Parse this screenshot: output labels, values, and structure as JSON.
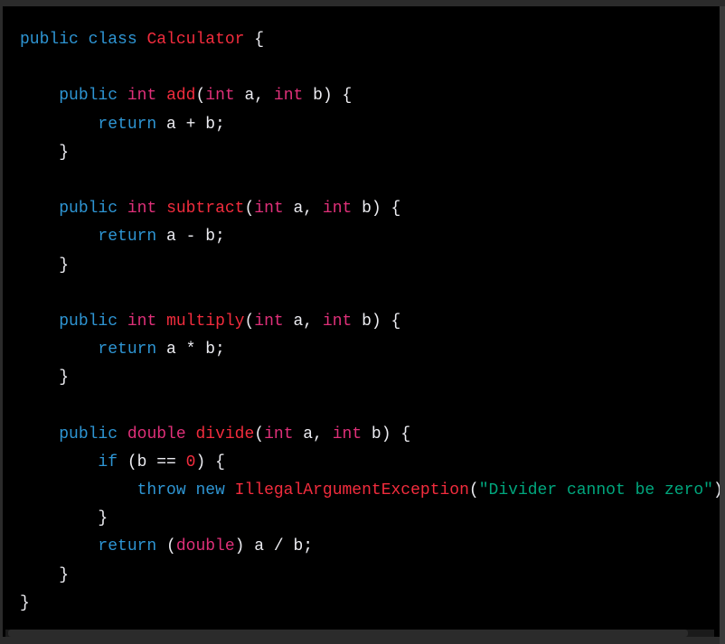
{
  "language": "java",
  "colors": {
    "keyword": "#2e95d3",
    "type": "#df3079",
    "function": "#f22c3d",
    "string": "#00a67d",
    "text": "#ececf1",
    "background": "#000000"
  },
  "lines": [
    [
      [
        "kw",
        "public"
      ],
      [
        "tx",
        " "
      ],
      [
        "kw",
        "class"
      ],
      [
        "tx",
        " "
      ],
      [
        "fn",
        "Calculator"
      ],
      [
        "tx",
        " {"
      ]
    ],
    [],
    [
      [
        "tx",
        "    "
      ],
      [
        "kw",
        "public"
      ],
      [
        "tx",
        " "
      ],
      [
        "ty",
        "int"
      ],
      [
        "tx",
        " "
      ],
      [
        "fn",
        "add"
      ],
      [
        "tx",
        "("
      ],
      [
        "ty",
        "int"
      ],
      [
        "tx",
        " a, "
      ],
      [
        "ty",
        "int"
      ],
      [
        "tx",
        " b) {"
      ]
    ],
    [
      [
        "tx",
        "        "
      ],
      [
        "kw",
        "return"
      ],
      [
        "tx",
        " a + b;"
      ]
    ],
    [
      [
        "tx",
        "    }"
      ]
    ],
    [],
    [
      [
        "tx",
        "    "
      ],
      [
        "kw",
        "public"
      ],
      [
        "tx",
        " "
      ],
      [
        "ty",
        "int"
      ],
      [
        "tx",
        " "
      ],
      [
        "fn",
        "subtract"
      ],
      [
        "tx",
        "("
      ],
      [
        "ty",
        "int"
      ],
      [
        "tx",
        " a, "
      ],
      [
        "ty",
        "int"
      ],
      [
        "tx",
        " b) {"
      ]
    ],
    [
      [
        "tx",
        "        "
      ],
      [
        "kw",
        "return"
      ],
      [
        "tx",
        " a - b;"
      ]
    ],
    [
      [
        "tx",
        "    }"
      ]
    ],
    [],
    [
      [
        "tx",
        "    "
      ],
      [
        "kw",
        "public"
      ],
      [
        "tx",
        " "
      ],
      [
        "ty",
        "int"
      ],
      [
        "tx",
        " "
      ],
      [
        "fn",
        "multiply"
      ],
      [
        "tx",
        "("
      ],
      [
        "ty",
        "int"
      ],
      [
        "tx",
        " a, "
      ],
      [
        "ty",
        "int"
      ],
      [
        "tx",
        " b) {"
      ]
    ],
    [
      [
        "tx",
        "        "
      ],
      [
        "kw",
        "return"
      ],
      [
        "tx",
        " a * b;"
      ]
    ],
    [
      [
        "tx",
        "    }"
      ]
    ],
    [],
    [
      [
        "tx",
        "    "
      ],
      [
        "kw",
        "public"
      ],
      [
        "tx",
        " "
      ],
      [
        "ty",
        "double"
      ],
      [
        "tx",
        " "
      ],
      [
        "fn",
        "divide"
      ],
      [
        "tx",
        "("
      ],
      [
        "ty",
        "int"
      ],
      [
        "tx",
        " a, "
      ],
      [
        "ty",
        "int"
      ],
      [
        "tx",
        " b) {"
      ]
    ],
    [
      [
        "tx",
        "        "
      ],
      [
        "kw",
        "if"
      ],
      [
        "tx",
        " (b == "
      ],
      [
        "nu",
        "0"
      ],
      [
        "tx",
        ") {"
      ]
    ],
    [
      [
        "tx",
        "            "
      ],
      [
        "kw",
        "throw"
      ],
      [
        "tx",
        " "
      ],
      [
        "kw",
        "new"
      ],
      [
        "tx",
        " "
      ],
      [
        "fn",
        "IllegalArgumentException"
      ],
      [
        "tx",
        "("
      ],
      [
        "st",
        "\"Divider cannot be zero\""
      ],
      [
        "tx",
        ");"
      ]
    ],
    [
      [
        "tx",
        "        }"
      ]
    ],
    [
      [
        "tx",
        "        "
      ],
      [
        "kw",
        "return"
      ],
      [
        "tx",
        " ("
      ],
      [
        "ty",
        "double"
      ],
      [
        "tx",
        ") a / b;"
      ]
    ],
    [
      [
        "tx",
        "    }"
      ]
    ],
    [
      [
        "tx",
        "}"
      ]
    ]
  ]
}
